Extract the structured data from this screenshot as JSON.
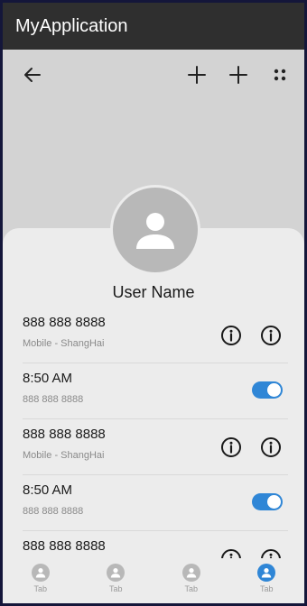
{
  "app": {
    "title": "MyApplication"
  },
  "profile": {
    "name": "User Name"
  },
  "rows": [
    {
      "title": "888 888 8888",
      "subtitle": "Mobile - ShangHai",
      "kind": "info"
    },
    {
      "title": "8:50 AM",
      "subtitle": "888 888 8888",
      "kind": "toggle",
      "on": true
    },
    {
      "title": "888 888 8888",
      "subtitle": "Mobile - ShangHai",
      "kind": "info"
    },
    {
      "title": "8:50 AM",
      "subtitle": "888 888 8888",
      "kind": "toggle",
      "on": true
    },
    {
      "title": "888 888 8888",
      "subtitle": "",
      "kind": "info"
    }
  ],
  "tabs": [
    {
      "label": "Tab",
      "active": false
    },
    {
      "label": "Tab",
      "active": false
    },
    {
      "label": "Tab",
      "active": false
    },
    {
      "label": "Tab",
      "active": true
    }
  ],
  "colors": {
    "accent": "#2f86d6",
    "appbar": "#2f2f2f",
    "sheet": "#ececec",
    "header": "#d3d3d3"
  },
  "icons": {
    "back": "arrow-left-icon",
    "add": "plus-icon",
    "more": "grid-dots-icon",
    "info": "info-circle-icon",
    "person": "person-icon"
  }
}
